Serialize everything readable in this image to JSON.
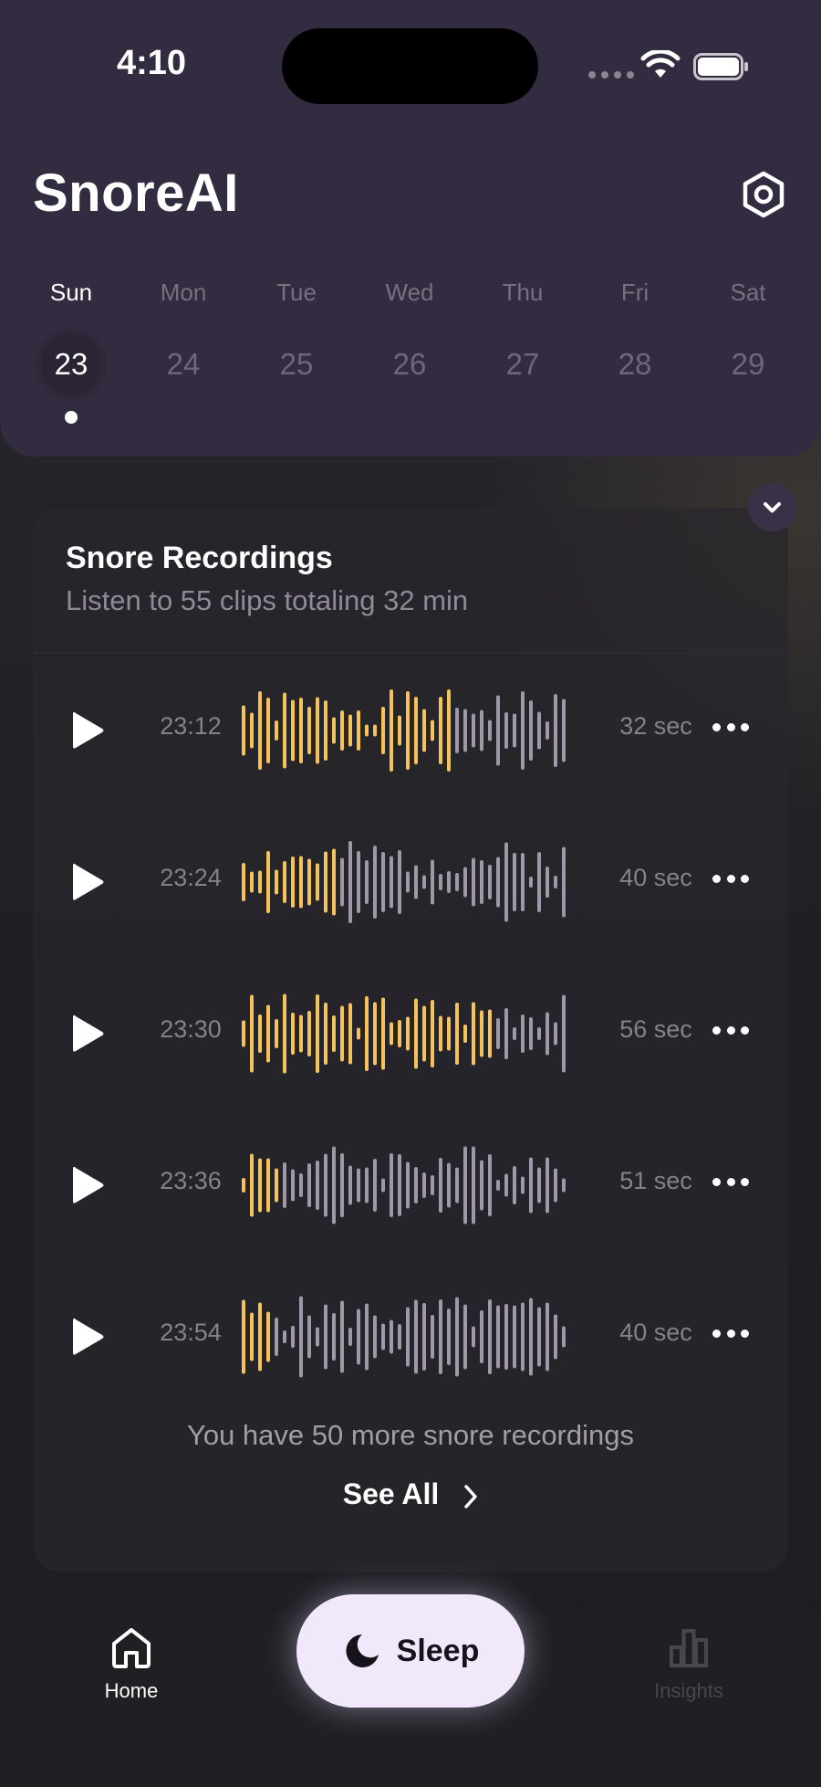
{
  "status_bar": {
    "time": "4:10"
  },
  "header": {
    "app_title": "SnoreAI",
    "days": [
      {
        "name": "Sun",
        "num": "23",
        "selected": true
      },
      {
        "name": "Mon",
        "num": "24"
      },
      {
        "name": "Tue",
        "num": "25"
      },
      {
        "name": "Wed",
        "num": "26"
      },
      {
        "name": "Thu",
        "num": "27"
      },
      {
        "name": "Fri",
        "num": "28"
      },
      {
        "name": "Sat",
        "num": "29"
      }
    ]
  },
  "recordings": {
    "title": "Snore Recordings",
    "subtitle": "Listen to 55 clips totaling 32 min",
    "items": [
      {
        "time": "23:12",
        "duration": "32 sec",
        "played_fraction": 0.64
      },
      {
        "time": "23:24",
        "duration": "40 sec",
        "played_fraction": 0.29
      },
      {
        "time": "23:30",
        "duration": "56 sec",
        "played_fraction": 0.77
      },
      {
        "time": "23:36",
        "duration": "51 sec",
        "played_fraction": 0.12
      },
      {
        "time": "23:54",
        "duration": "40 sec",
        "played_fraction": 0.09
      }
    ],
    "more_note": "You have 50 more snore recordings",
    "see_all_label": "See All"
  },
  "tabbar": {
    "home_label": "Home",
    "sleep_label": "Sleep",
    "insights_label": "Insights"
  },
  "colors": {
    "header_bg": "#332b40",
    "wave_played": "#f6c35b",
    "wave_unplayed": "#9f98a8",
    "sleep_button": "#f1e8fb"
  }
}
